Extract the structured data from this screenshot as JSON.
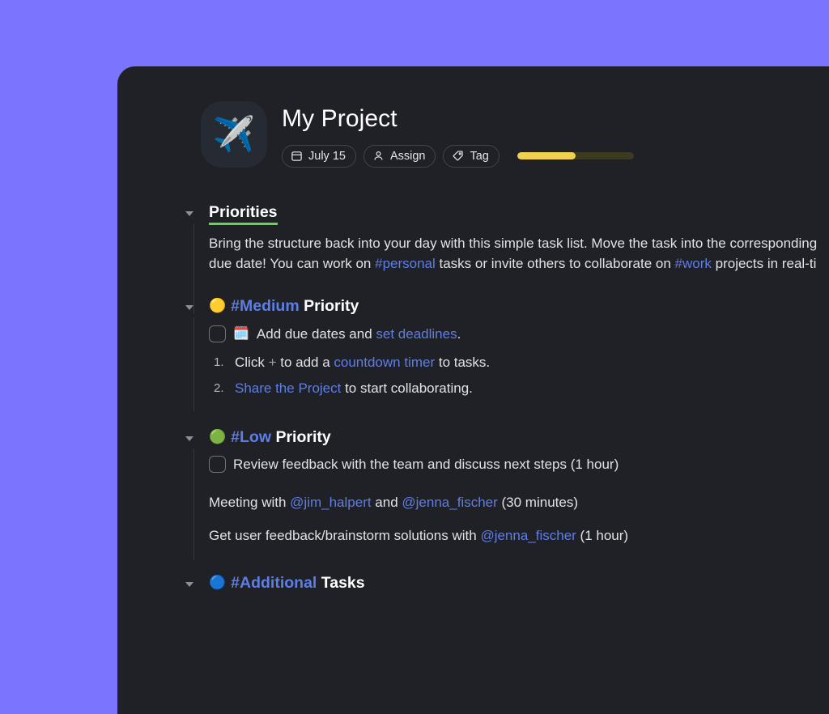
{
  "background_color": "#7b74fc",
  "card_color": "#202127",
  "accent": {
    "link_blue": "#5d7ee4",
    "underline_green": "#5fd94f",
    "progress_yellow": "#efd04f"
  },
  "header": {
    "emoji": "✈️",
    "emoji_name": "airplane-emoji",
    "title": "My Project",
    "chips": [
      {
        "icon": "calendar-icon",
        "label": "July 15"
      },
      {
        "icon": "person-icon",
        "label": "Assign"
      },
      {
        "icon": "tag-icon",
        "label": "Tag"
      }
    ],
    "progress_percent": 50
  },
  "sections": {
    "priorities": {
      "heading": "Priorities",
      "paragraph": {
        "part1": "Bring the structure back into your day with this simple task list. Move the task into the corresponding",
        "part2_pre": "due date! You can work on ",
        "tag_personal": "#personal",
        "part2_mid": " tasks or invite others to collaborate on ",
        "tag_work": "#work",
        "part2_post": " projects in real-ti"
      }
    },
    "medium": {
      "bullet_emoji": "🟡",
      "tag": "#Medium",
      "heading_rest": "Priority",
      "todo": {
        "emoji": "🗓️",
        "text_pre": "Add due dates and ",
        "link": "set deadlines",
        "text_post": "."
      },
      "numbered": [
        {
          "num": "1.",
          "pre": "Click ",
          "plus": "+",
          "mid": " to add a ",
          "link": "countdown timer",
          "post": " to tasks."
        },
        {
          "num": "2.",
          "pre": "",
          "link": "Share the Project",
          "post": " to start collaborating."
        }
      ]
    },
    "low": {
      "bullet_emoji": "🟢",
      "tag": "#Low",
      "heading_rest": "Priority",
      "todo_text": "Review feedback with the team and discuss next steps (1 hour)",
      "lines": [
        {
          "pre": "Meeting with ",
          "mention1": "@jim_halpert",
          "mid": " and ",
          "mention2": "@jenna_fischer",
          "post": " (30 minutes)"
        },
        {
          "pre": "Get user feedback/brainstorm solutions with ",
          "mention1": "@jenna_fischer",
          "post": " (1 hour)"
        }
      ]
    },
    "additional": {
      "bullet_emoji": "🔵",
      "tag": "#Additional",
      "heading_rest": "Tasks"
    }
  }
}
